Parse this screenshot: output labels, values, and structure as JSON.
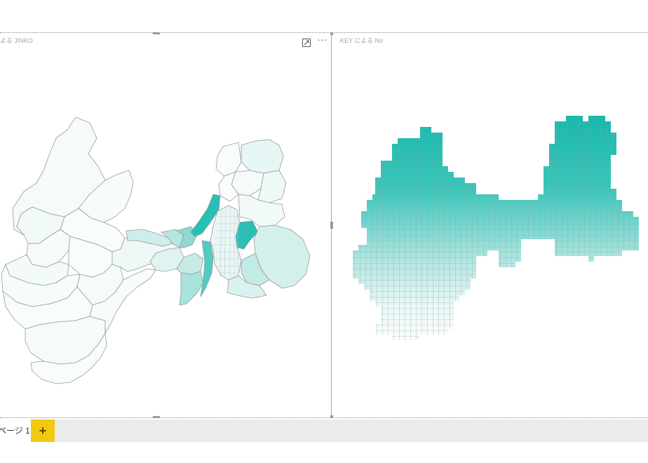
{
  "report": {
    "visuals": [
      {
        "title": "よる JINKO"
      },
      {
        "title": "KEY による No"
      }
    ],
    "toolbar": {
      "focus_icon": "focus-mode-icon",
      "more_icon": "more-options-icon",
      "more_glyph": "···"
    }
  },
  "colors": {
    "accent": "#01b8aa",
    "light": "#ffffff",
    "border": "#a6a6a6",
    "tab_add": "#f2c811"
  },
  "pages": {
    "tabs": [
      {
        "label": "ページ 1"
      }
    ],
    "add_label": "+"
  }
}
